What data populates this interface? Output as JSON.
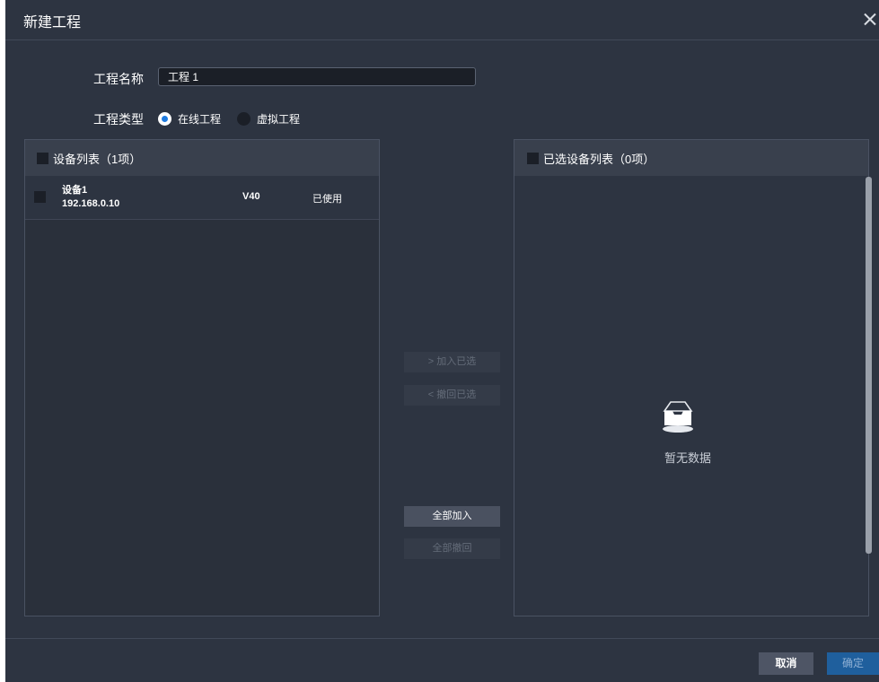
{
  "dialog": {
    "title": "新建工程"
  },
  "form": {
    "name_label": "工程名称",
    "name_value": "工程 1",
    "type_label": "工程类型",
    "type_options": [
      {
        "label": "在线工程",
        "selected": true
      },
      {
        "label": "虚拟工程",
        "selected": false
      }
    ]
  },
  "device_list": {
    "title": "设备列表（1项）",
    "items": [
      {
        "name": "设备1",
        "ip": "192.168.0.10",
        "version": "V40",
        "status": "已使用",
        "checked": false
      }
    ]
  },
  "selected_list": {
    "title": "已选设备列表（0项）",
    "empty_text": "暂无数据"
  },
  "transfer_buttons": {
    "add_selected": "> 加入已选",
    "remove_selected": "< 撤回已选",
    "add_all": "全部加入",
    "remove_all": "全部撤回"
  },
  "footer": {
    "cancel": "取消",
    "confirm": "确定"
  },
  "colors": {
    "background": "#2d3441",
    "panel": "#2a303b",
    "accent": "#1e7be0",
    "confirm_button": "#1f5f9d"
  },
  "icons": [
    "close-icon",
    "empty-box-icon",
    "checkbox",
    "radio"
  ]
}
